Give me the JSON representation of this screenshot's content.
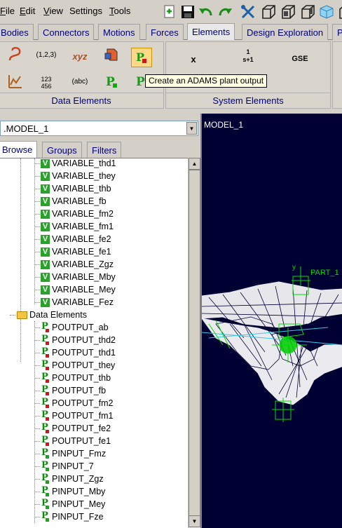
{
  "menu": {
    "items": [
      {
        "label_ul": "F",
        "label_rest": "ile"
      },
      {
        "label_ul": "E",
        "label_rest": "dit"
      },
      {
        "label_ul": "V",
        "label_rest": "iew"
      },
      {
        "label_ul": "",
        "label_rest": "Settings"
      },
      {
        "label_ul": "T",
        "label_rest": "ools"
      }
    ]
  },
  "tabs": [
    "Bodies",
    "Connectors",
    "Motions",
    "Forces",
    "Elements",
    "Design Exploration",
    "P"
  ],
  "active_tab": "Elements",
  "ribbon": {
    "data_elements_label": "Data Elements",
    "system_elements_label": "System Elements",
    "icon_text": {
      "array": "(1,2,3)",
      "xyz": "xyz",
      "matrix": "123\n456",
      "string": "(abc)",
      "variable": "x",
      "transfer": "1\ns+1",
      "gse": "GSE"
    },
    "tooltip": "Create an ADAMS plant output"
  },
  "model_selector": {
    "value": ".MODEL_1"
  },
  "browser_tabs": [
    "Browse",
    "Groups",
    "Filters"
  ],
  "active_browser_tab": "Browse",
  "tree": {
    "variables": [
      "VARIABLE_thd1",
      "VARIABLE_they",
      "VARIABLE_thb",
      "VARIABLE_fb",
      "VARIABLE_fm2",
      "VARIABLE_fm1",
      "VARIABLE_fe2",
      "VARIABLE_fe1",
      "VARIABLE_Zgz",
      "VARIABLE_Mby",
      "VARIABLE_Mey",
      "VARIABLE_Fez"
    ],
    "data_elements_folder": "Data Elements",
    "outputs": [
      "POUTPUT_ab",
      "POUTPUT_thd2",
      "POUTPUT_thd1",
      "POUTPUT_they",
      "POUTPUT_thb",
      "POUTPUT_fb",
      "POUTPUT_fm2",
      "POUTPUT_fm1",
      "POUTPUT_fe2",
      "POUTPUT_fe1"
    ],
    "inputs": [
      "PINPUT_Fmz",
      "PINPUT_7",
      "PINPUT_Zgz",
      "PINPUT_Mby",
      "PINPUT_Mey",
      "PINPUT_Fze"
    ]
  },
  "viewport": {
    "title": "MODEL_1",
    "part_label": "PART_1",
    "axis_label": "y"
  },
  "colors": {
    "viewport_bg": "#000033",
    "wire": "#ffffff",
    "marker": "#00dd00",
    "axis": "#33ccee"
  }
}
